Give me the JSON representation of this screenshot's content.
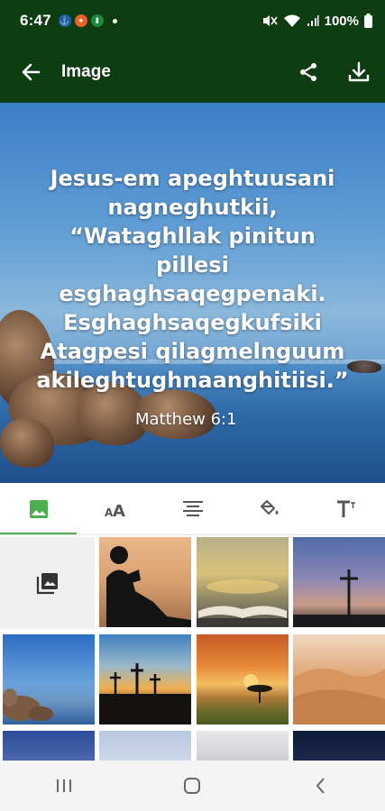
{
  "status_bar": {
    "time": "6:47",
    "battery": "100%",
    "icons": [
      "app-icon-blue",
      "app-icon-orange",
      "app-icon-green",
      "mute-icon",
      "wifi-icon",
      "signal-icon",
      "battery-icon"
    ]
  },
  "app_bar": {
    "title": "Image",
    "icons": [
      "back-arrow-icon",
      "share-icon",
      "download-icon"
    ]
  },
  "preview": {
    "quote_lines": [
      "Jesus-em apeghtuusani",
      "nagneghutkii,",
      "“Wataghllak pinitun",
      "pillesi",
      "esghaghsaqegpenaki.",
      "Esghaghsaqegkufsiki",
      "Atagpesi qilagmelnguum",
      "akileghtughnaanghitiisi.”"
    ],
    "reference": "Matthew 6:1"
  },
  "tabs": [
    {
      "name": "image-icon",
      "active": true
    },
    {
      "name": "font-size-icon",
      "active": false
    },
    {
      "name": "align-center-icon",
      "active": false
    },
    {
      "name": "fill-color-icon",
      "active": false
    },
    {
      "name": "text-format-icon",
      "active": false
    }
  ],
  "grid": {
    "tiles": [
      "gallery-picker",
      "silhouette-reading",
      "open-bible-sunset",
      "cross-dusk",
      "lake-rocks",
      "three-crosses",
      "savanna-sunset",
      "desert-dunes",
      "clouds-blue",
      "clouds-pale",
      "sky-mountains",
      "dark-sky"
    ]
  },
  "nav_bar": {
    "icons": [
      "recent-apps-icon",
      "home-icon",
      "back-icon"
    ]
  },
  "colors": {
    "app_bar": "#0e3d12",
    "accent": "#4caf50"
  }
}
